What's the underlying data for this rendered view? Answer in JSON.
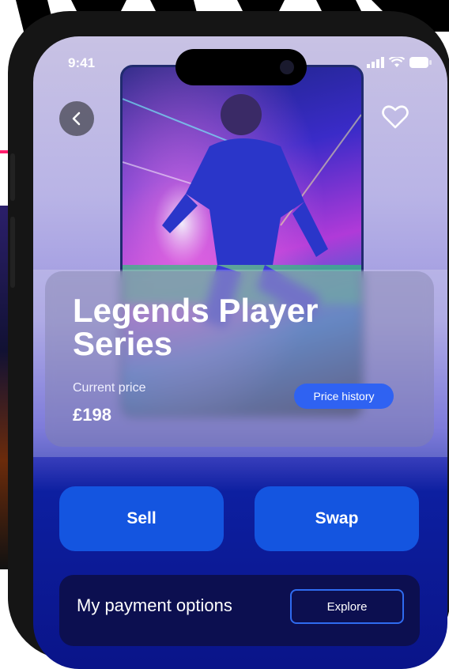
{
  "status_bar": {
    "time": "9:41"
  },
  "product": {
    "title": "Legends Player Series",
    "price_label": "Current price",
    "price_value": "£198"
  },
  "buttons": {
    "price_history": "Price history",
    "sell": "Sell",
    "swap": "Swap"
  },
  "payment": {
    "title": "My payment options",
    "explore": "Explore"
  },
  "icons": {
    "back": "chevron-left-icon",
    "favorite": "heart-icon",
    "signal": "signal-icon",
    "wifi": "wifi-icon",
    "battery": "battery-icon"
  },
  "colors": {
    "primary_button": "#1455e0",
    "history_button": "#2f62f2",
    "payment_card": "#0c0f50"
  }
}
